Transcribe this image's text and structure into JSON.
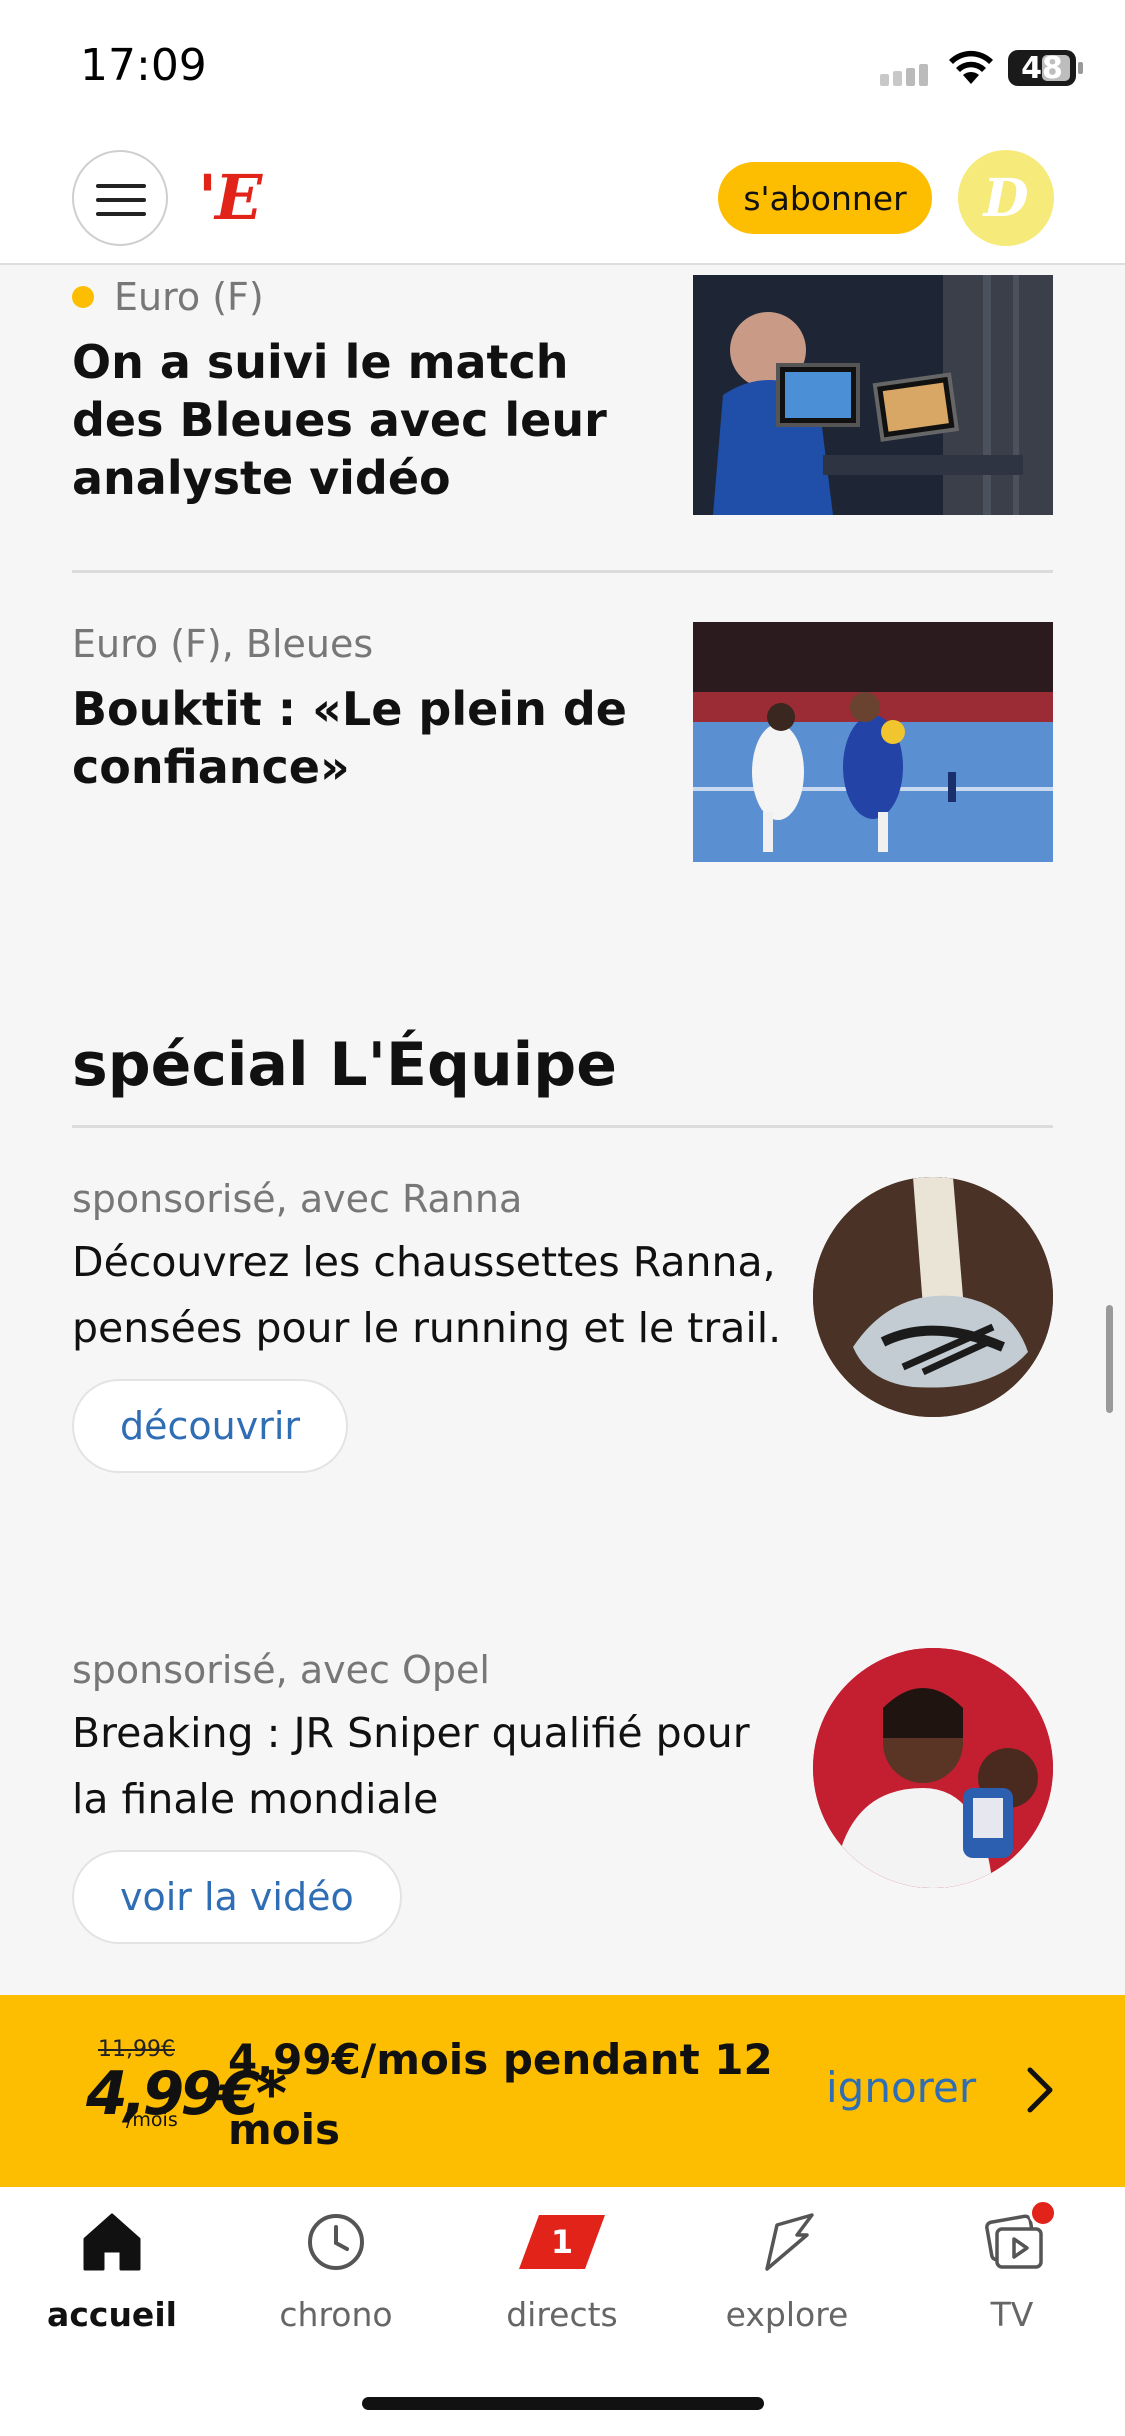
{
  "status_bar": {
    "time": "17:09",
    "battery": "48"
  },
  "header": {
    "logo": "'E",
    "subscribe_label": "s'abonner",
    "avatar_letter": "D"
  },
  "articles": [
    {
      "category": "Euro (F)",
      "title": "On a suivi le match des Bleues avec leur analyste vidéo",
      "live_dot": true
    },
    {
      "category": "Euro (F), Bleues",
      "title": "Bouktit : «Le plein de confiance»",
      "live_dot": false
    }
  ],
  "section": {
    "title": "spécial L'Équipe"
  },
  "sponsored": [
    {
      "label": "sponsorisé, avec Ranna",
      "text": "Découvrez les chaussettes Ranna, pensées pour le running et le trail.",
      "button": "découvrir"
    },
    {
      "label": "sponsorisé, avec Opel",
      "text": "Breaking : JR Sniper qualifié pour la finale mondiale",
      "button": "voir la vidéo"
    }
  ],
  "promo": {
    "old_price": "11,99€",
    "new_price": "4,99€*",
    "per": "/mois",
    "text": "4,99€/mois pendant 12 mois",
    "ignore_label": "ignorer"
  },
  "bottom_nav": {
    "items": [
      {
        "label": "accueil",
        "icon": "home-icon",
        "active": true
      },
      {
        "label": "chrono",
        "icon": "clock-icon",
        "active": false
      },
      {
        "label": "directs",
        "icon": "live-badge-icon",
        "badge": "1",
        "active": false
      },
      {
        "label": "explore",
        "icon": "lightning-icon",
        "active": false
      },
      {
        "label": "TV",
        "icon": "tv-play-icon",
        "active": false
      }
    ]
  },
  "colors": {
    "accent": "#fdbd00",
    "brand_red": "#e2231a",
    "link_blue": "#2f6db5"
  }
}
